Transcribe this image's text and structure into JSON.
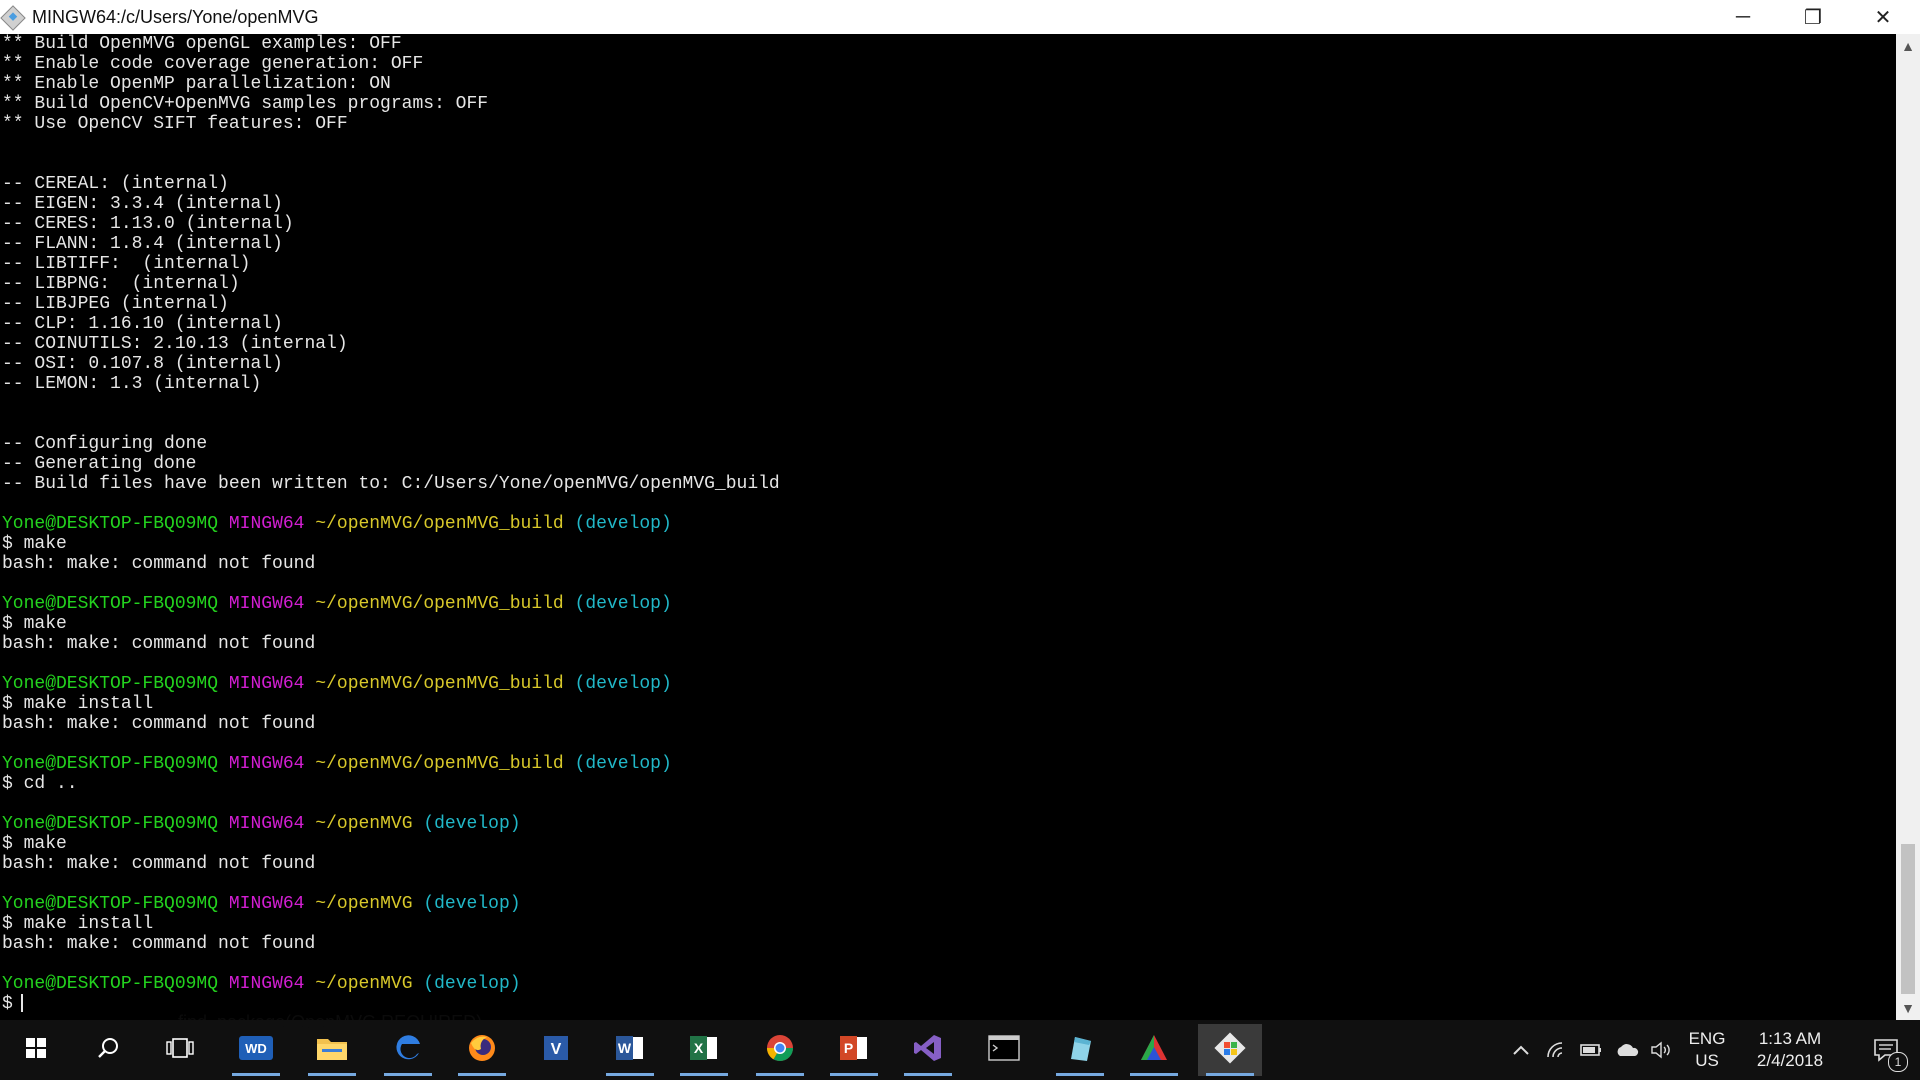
{
  "window": {
    "title": "MINGW64:/c/Users/Yone/openMVG",
    "minimize_label": "─",
    "restore_label": "❐",
    "close_label": "✕"
  },
  "terminal": {
    "lines": [
      {
        "text": "** Build OpenMVG openGL examples: OFF"
      },
      {
        "text": "** Enable code coverage generation: OFF"
      },
      {
        "text": "** Enable OpenMP parallelization: ON"
      },
      {
        "text": "** Build OpenCV+OpenMVG samples programs: OFF"
      },
      {
        "text": "** Use OpenCV SIFT features: OFF"
      },
      {
        "text": ""
      },
      {
        "text": ""
      },
      {
        "text": "-- CEREAL: (internal)"
      },
      {
        "text": "-- EIGEN: 3.3.4 (internal)"
      },
      {
        "text": "-- CERES: 1.13.0 (internal)"
      },
      {
        "text": "-- FLANN: 1.8.4 (internal)"
      },
      {
        "text": "-- LIBTIFF:  (internal)"
      },
      {
        "text": "-- LIBPNG:  (internal)"
      },
      {
        "text": "-- LIBJPEG (internal)"
      },
      {
        "text": "-- CLP: 1.16.10 (internal)"
      },
      {
        "text": "-- COINUTILS: 2.10.13 (internal)"
      },
      {
        "text": "-- OSI: 0.107.8 (internal)"
      },
      {
        "text": "-- LEMON: 1.3 (internal)"
      },
      {
        "text": ""
      },
      {
        "text": ""
      },
      {
        "text": "-- Configuring done"
      },
      {
        "text": "-- Generating done"
      },
      {
        "text": "-- Build files have been written to: C:/Users/Yone/openMVG/openMVG_build"
      },
      {
        "text": ""
      },
      {
        "prompt": {
          "user": "Yone@DESKTOP-FBQ09MQ",
          "host": "MINGW64",
          "path": "~/openMVG/openMVG_build",
          "branch": "(develop)"
        }
      },
      {
        "text": "$ make"
      },
      {
        "text": "bash: make: command not found"
      },
      {
        "text": ""
      },
      {
        "prompt": {
          "user": "Yone@DESKTOP-FBQ09MQ",
          "host": "MINGW64",
          "path": "~/openMVG/openMVG_build",
          "branch": "(develop)"
        }
      },
      {
        "text": "$ make"
      },
      {
        "text": "bash: make: command not found"
      },
      {
        "text": ""
      },
      {
        "prompt": {
          "user": "Yone@DESKTOP-FBQ09MQ",
          "host": "MINGW64",
          "path": "~/openMVG/openMVG_build",
          "branch": "(develop)"
        }
      },
      {
        "text": "$ make install"
      },
      {
        "text": "bash: make: command not found"
      },
      {
        "text": ""
      },
      {
        "prompt": {
          "user": "Yone@DESKTOP-FBQ09MQ",
          "host": "MINGW64",
          "path": "~/openMVG/openMVG_build",
          "branch": "(develop)"
        }
      },
      {
        "text": "$ cd .."
      },
      {
        "text": ""
      },
      {
        "prompt": {
          "user": "Yone@DESKTOP-FBQ09MQ",
          "host": "MINGW64",
          "path": "~/openMVG",
          "branch": "(develop)"
        }
      },
      {
        "text": "$ make"
      },
      {
        "text": "bash: make: command not found"
      },
      {
        "text": ""
      },
      {
        "prompt": {
          "user": "Yone@DESKTOP-FBQ09MQ",
          "host": "MINGW64",
          "path": "~/openMVG",
          "branch": "(develop)"
        }
      },
      {
        "text": "$ make install"
      },
      {
        "text": "bash: make: command not found"
      },
      {
        "text": ""
      },
      {
        "prompt": {
          "user": "Yone@DESKTOP-FBQ09MQ",
          "host": "MINGW64",
          "path": "~/openMVG",
          "branch": "(develop)"
        }
      },
      {
        "text": "$",
        "cursor": true
      }
    ]
  },
  "tooltip_bleed": "find_package(OpenMVG REQUIRED)",
  "taskbar": {
    "apps": [
      {
        "name": "start-button",
        "icon": "windows-logo-icon"
      },
      {
        "name": "search-button",
        "icon": "search-icon"
      },
      {
        "name": "task-view-button",
        "icon": "task-view-icon"
      },
      {
        "name": "taskbar-wd",
        "icon": "wd-icon",
        "label": "WD"
      },
      {
        "name": "taskbar-file-explorer",
        "icon": "folder-icon"
      },
      {
        "name": "taskbar-edge",
        "icon": "edge-icon"
      },
      {
        "name": "taskbar-firefox",
        "icon": "firefox-icon"
      },
      {
        "name": "taskbar-visual-studio-code",
        "icon": "vs-icon"
      },
      {
        "name": "taskbar-word",
        "icon": "word-icon"
      },
      {
        "name": "taskbar-excel",
        "icon": "excel-icon"
      },
      {
        "name": "taskbar-chrome",
        "icon": "chrome-icon"
      },
      {
        "name": "taskbar-powerpoint",
        "icon": "powerpoint-icon"
      },
      {
        "name": "taskbar-visual-studio",
        "icon": "visual-studio-icon"
      },
      {
        "name": "taskbar-cmd",
        "icon": "terminal-icon"
      },
      {
        "name": "taskbar-app-blue",
        "icon": "app-blue-icon"
      },
      {
        "name": "taskbar-app-triangle",
        "icon": "triangle-app-icon"
      },
      {
        "name": "taskbar-git-bash",
        "icon": "git-bash-icon",
        "active": true
      }
    ],
    "tray": {
      "lang_line1": "ENG",
      "lang_line2": "US",
      "time": "1:13 AM",
      "date": "2/4/2018",
      "notification_count": "1"
    }
  },
  "colors": {
    "user": "#23d21e",
    "host": "#d21ed2",
    "path": "#d8c82a",
    "branch": "#21b8c8",
    "text": "#e6e6e6"
  }
}
